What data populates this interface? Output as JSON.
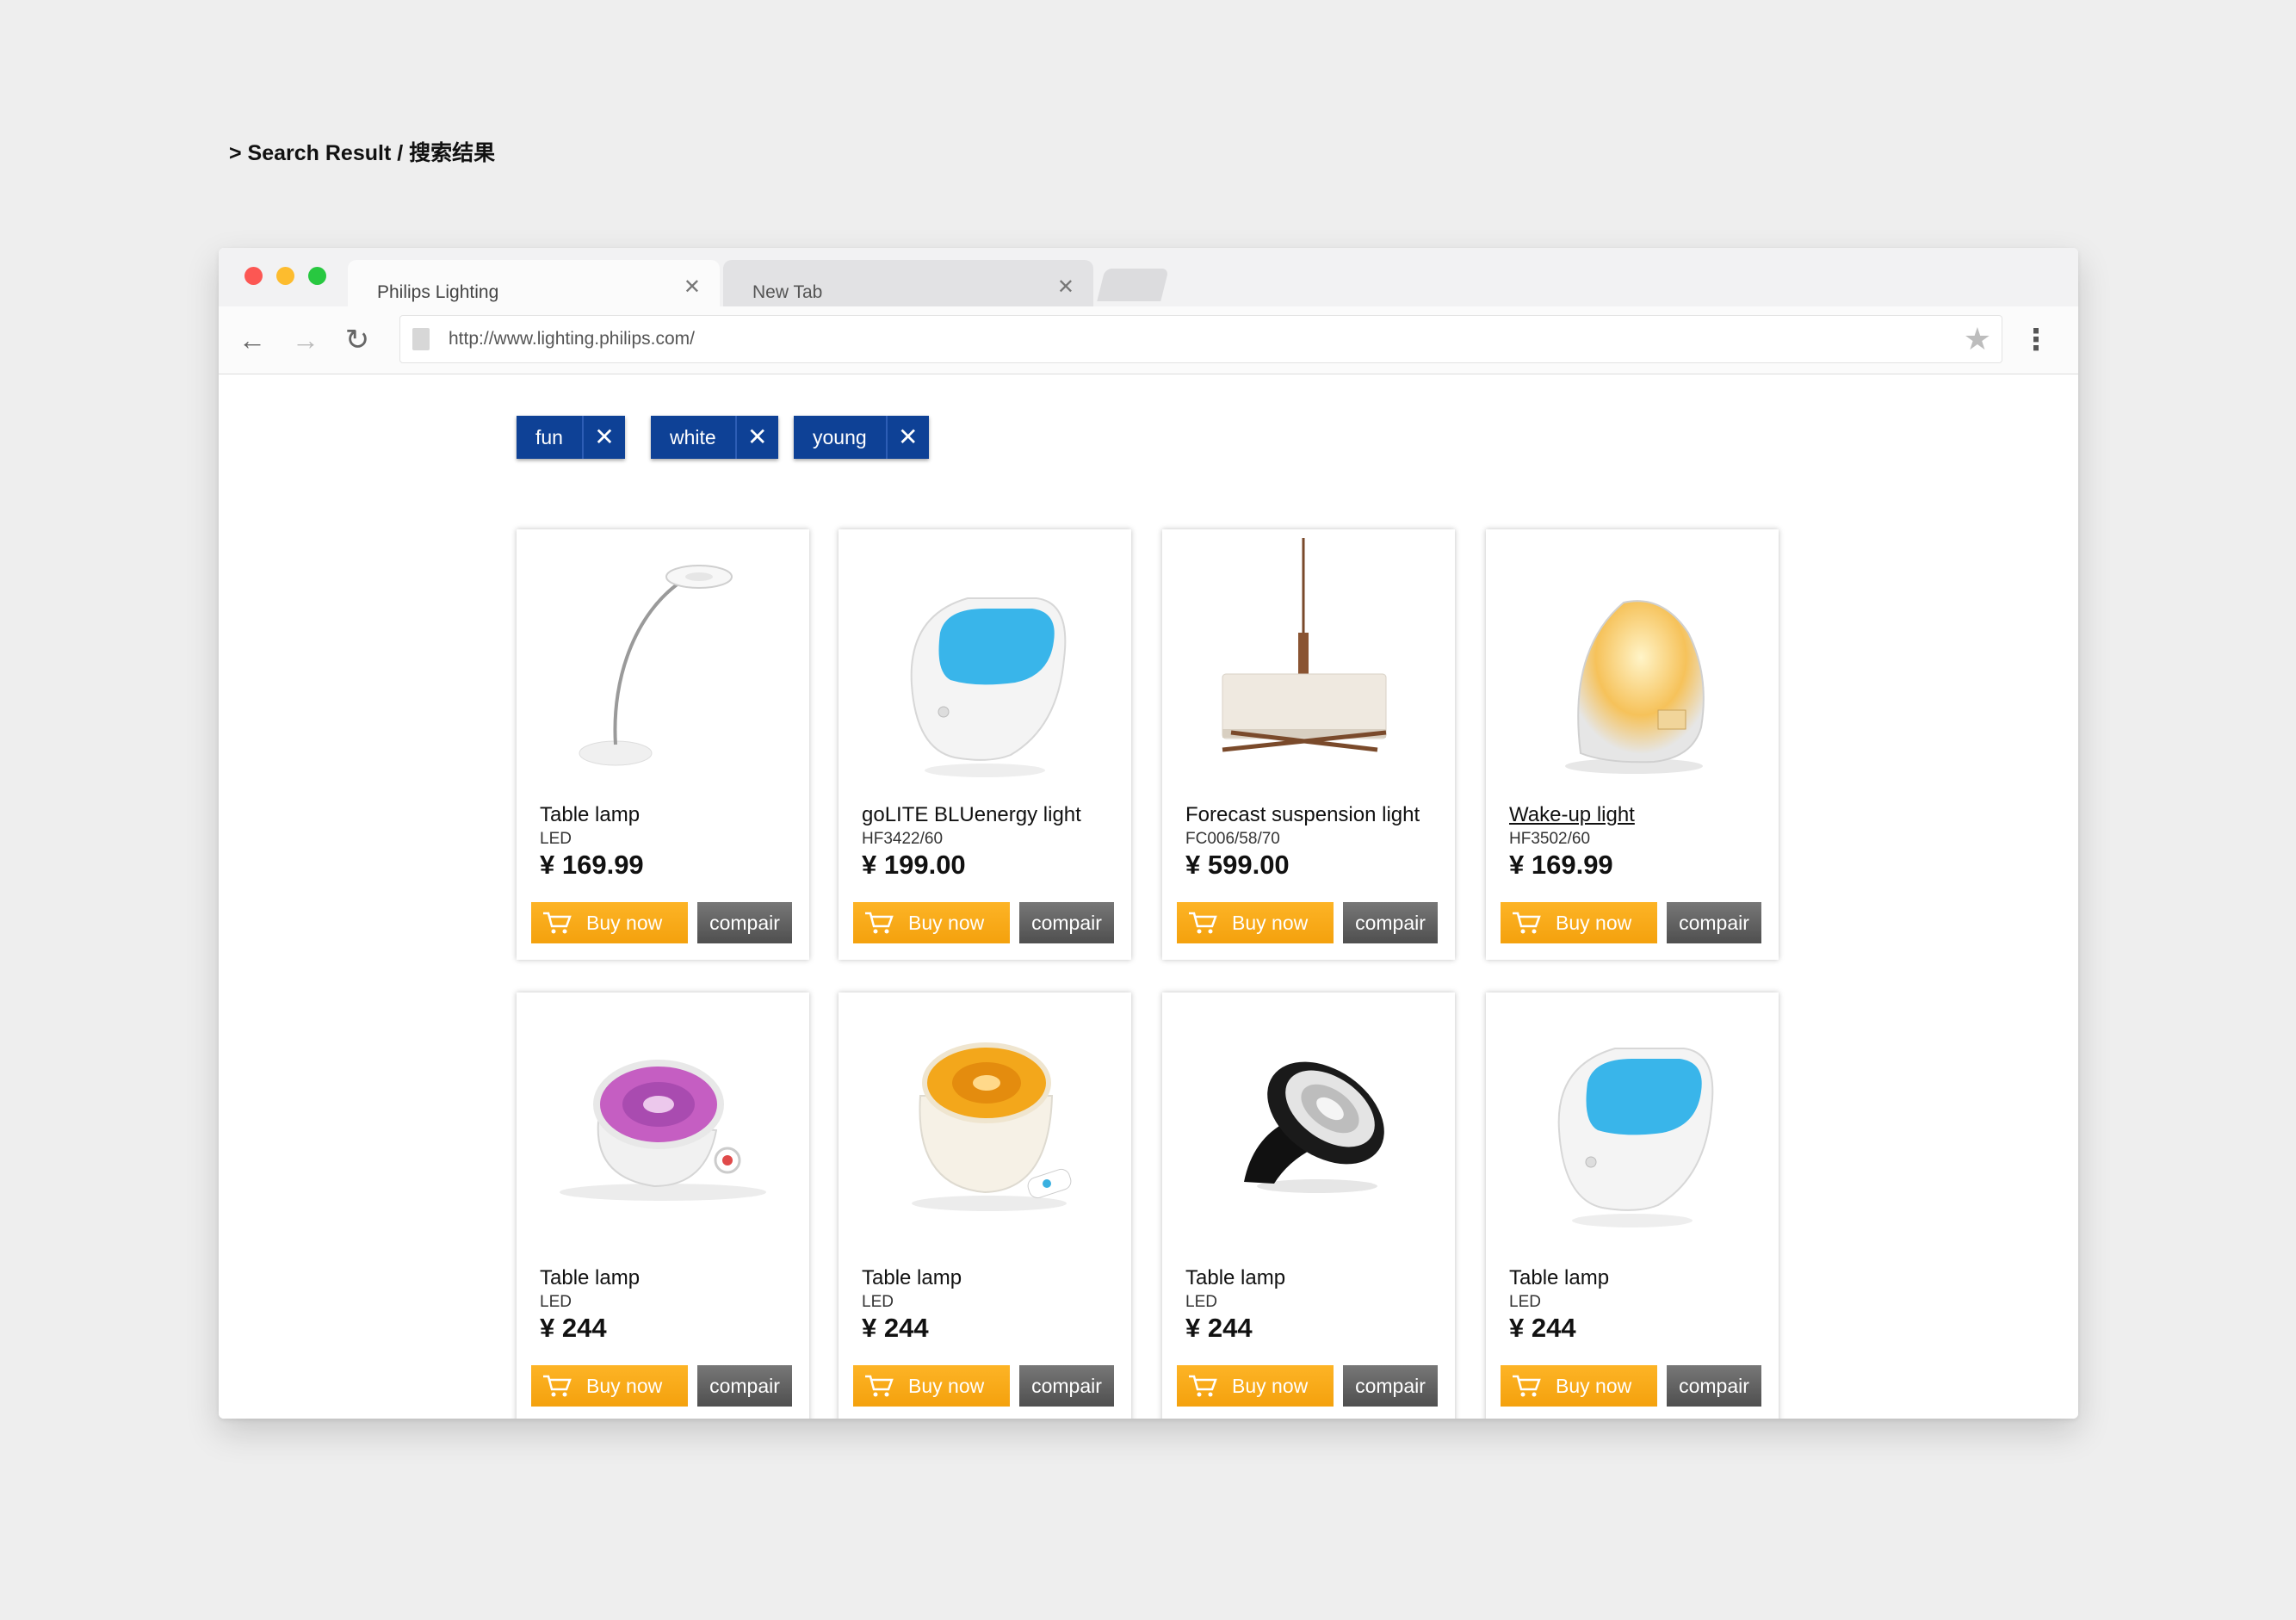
{
  "page_heading": "> Search Result / 搜索结果",
  "browser": {
    "tabs": [
      {
        "label": "Philips Lighting",
        "active": true
      },
      {
        "label": "New Tab",
        "active": false
      }
    ],
    "url": "http://www.lighting.philips.com/",
    "icons": {
      "back": "←",
      "forward": "→",
      "reload": "↻",
      "star": "★",
      "menu": "⋮",
      "close": "✕"
    }
  },
  "colors": {
    "chip": "#0e4196",
    "buy": "#f4a10d",
    "compare": "#5a5a5a"
  },
  "filters": [
    {
      "label": "fun"
    },
    {
      "label": "white"
    },
    {
      "label": "young"
    }
  ],
  "products": [
    {
      "name": "Table lamp",
      "model": "LED",
      "price": "¥ 169.99",
      "buy_label": "Buy now",
      "compare_label": "compair",
      "image": "desk-lamp"
    },
    {
      "name": "goLITE BLUenergy light",
      "model": "HF3422/60",
      "price": "¥ 199.00",
      "buy_label": "Buy now",
      "compare_label": "compair",
      "image": "golite-light"
    },
    {
      "name": "Forecast suspension light",
      "model": "FC006/58/70",
      "price": "¥ 599.00",
      "buy_label": "Buy now",
      "compare_label": "compair",
      "image": "pendant-light"
    },
    {
      "name": "Wake-up light",
      "model": "HF3502/60",
      "price": "¥ 169.99",
      "buy_label": "Buy now",
      "compare_label": "compair",
      "image": "wakeup-light"
    },
    {
      "name": "Table lamp",
      "model": "LED",
      "price": "¥ 244",
      "buy_label": "Buy now",
      "compare_label": "compair",
      "image": "purple-iris-lamp"
    },
    {
      "name": "Table lamp",
      "model": "LED",
      "price": "¥ 244",
      "buy_label": "Buy now",
      "compare_label": "compair",
      "image": "orange-bloom-lamp"
    },
    {
      "name": "Table lamp",
      "model": "LED",
      "price": "¥ 244",
      "buy_label": "Buy now",
      "compare_label": "compair",
      "image": "black-bloom-lamp"
    },
    {
      "name": "Table lamp",
      "model": "LED",
      "price": "¥ 244",
      "buy_label": "Buy now",
      "compare_label": "compair",
      "image": "golite-light"
    }
  ]
}
